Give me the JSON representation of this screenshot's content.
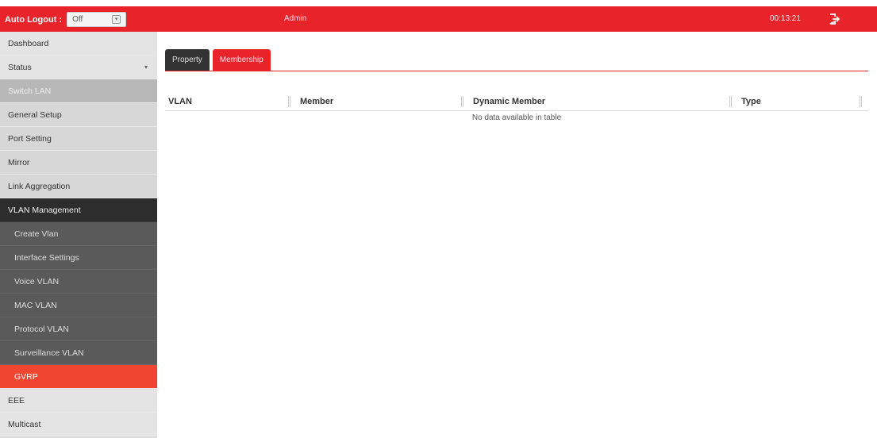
{
  "topbar": {
    "auto_logout_label": "Auto Logout :",
    "auto_logout_value": "Off",
    "user": "Admin",
    "time": "00:13:21",
    "logout_icon": "logout-icon"
  },
  "sidebar": {
    "items": [
      {
        "label": "Dashboard"
      },
      {
        "label": "Status"
      },
      {
        "label": "Switch LAN"
      },
      {
        "label": "General Setup"
      },
      {
        "label": "Port Setting"
      },
      {
        "label": "Mirror"
      },
      {
        "label": "Link Aggregation"
      },
      {
        "label": "VLAN Management"
      },
      {
        "label": "Create Vlan"
      },
      {
        "label": "Interface Settings"
      },
      {
        "label": "Voice VLAN"
      },
      {
        "label": "MAC VLAN"
      },
      {
        "label": "Protocol VLAN"
      },
      {
        "label": "Surveillance VLAN"
      },
      {
        "label": "GVRP"
      },
      {
        "label": "EEE"
      },
      {
        "label": "Multicast"
      }
    ]
  },
  "tabs": [
    {
      "label": "Property"
    },
    {
      "label": "Membership"
    }
  ],
  "table": {
    "columns": [
      "VLAN",
      "Member",
      "Dynamic Member",
      "Type"
    ],
    "empty_message": "No data available in table"
  },
  "colors": {
    "accent": "#e8242a",
    "active_item": "#f04530",
    "sidebar_dark": "#2d2d2d"
  }
}
